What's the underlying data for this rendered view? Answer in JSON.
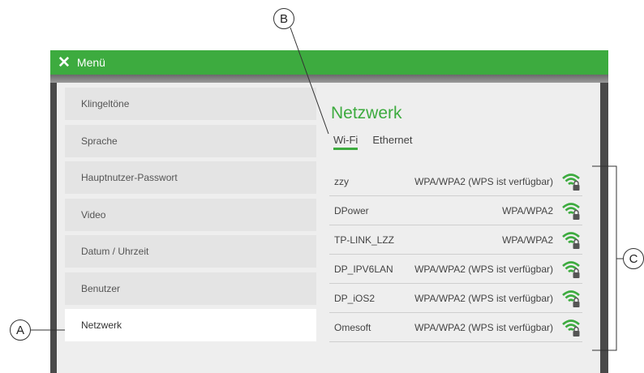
{
  "window": {
    "title": "Menü",
    "close_glyph": "✕"
  },
  "sidebar": {
    "items": [
      {
        "label": "Klingeltöne",
        "active": false
      },
      {
        "label": "Sprache",
        "active": false
      },
      {
        "label": "Hauptnutzer-Passwort",
        "active": false
      },
      {
        "label": "Video",
        "active": false
      },
      {
        "label": "Datum / Uhrzeit",
        "active": false
      },
      {
        "label": "Benutzer",
        "active": false
      },
      {
        "label": "Netzwerk",
        "active": true
      }
    ]
  },
  "network": {
    "title": "Netzwerk",
    "tabs": [
      {
        "label": "Wi-Fi",
        "active": true
      },
      {
        "label": "Ethernet",
        "active": false
      }
    ],
    "wifi_list": [
      {
        "ssid": "zzy",
        "security": "WPA/WPA2 (WPS ist verfügbar)",
        "icon": "wifi-locked-icon"
      },
      {
        "ssid": "DPower",
        "security": "WPA/WPA2",
        "icon": "wifi-locked-icon"
      },
      {
        "ssid": "TP-LINK_LZZ",
        "security": "WPA/WPA2",
        "icon": "wifi-locked-icon"
      },
      {
        "ssid": "DP_IPV6LAN",
        "security": "WPA/WPA2 (WPS ist verfügbar)",
        "icon": "wifi-locked-icon"
      },
      {
        "ssid": "DP_iOS2",
        "security": "WPA/WPA2 (WPS ist verfügbar)",
        "icon": "wifi-locked-icon"
      },
      {
        "ssid": "Omesoft",
        "security": "WPA/WPA2 (WPS ist verfügbar)",
        "icon": "wifi-locked-icon"
      }
    ]
  },
  "callouts": {
    "a": "A",
    "b": "B",
    "c": "C"
  },
  "colors": {
    "accent": "#3dab3f",
    "panel": "#eeeeee",
    "frame": "#4a4a4a"
  }
}
